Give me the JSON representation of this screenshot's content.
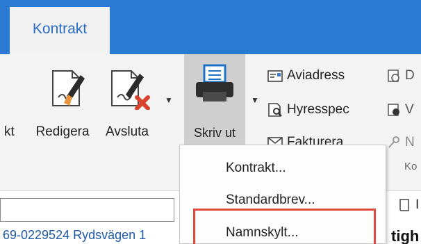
{
  "app": {
    "tab_active": "Kontrakt"
  },
  "ribbon": {
    "cut_label": "kt",
    "redigera_label": "Redigera",
    "avsluta_label": "Avsluta",
    "skriv_ut_label": "Skriv ut",
    "aviadress_label": "Aviadress",
    "hyresspec_label": "Hyresspec",
    "fakturera_label": "Fakturera",
    "cut_right_1": "D",
    "cut_right_2": "V",
    "cut_right_3": "N",
    "group_label_cut": "Ko"
  },
  "dropdown": {
    "items": [
      "Kontrakt...",
      "Standardbrev...",
      "Namnskylt..."
    ],
    "highlighted": "Namnskylt..."
  },
  "content": {
    "row_text": "69-0229524 Rydsvägen 1",
    "bold_text": "tigh",
    "toolbar_cut": "I"
  },
  "colors": {
    "titlebar": "#2a7ad3",
    "tab_text": "#2a6cc4",
    "pressed": "#cfcfcf",
    "highlight": "#e04a3e",
    "link": "#1e5aa8"
  },
  "icons": [
    "document-edit-icon",
    "document-close-icon",
    "printer-icon",
    "aviadress-icon",
    "hyresspec-icon",
    "envelope-icon",
    "chevron-down-icon"
  ]
}
